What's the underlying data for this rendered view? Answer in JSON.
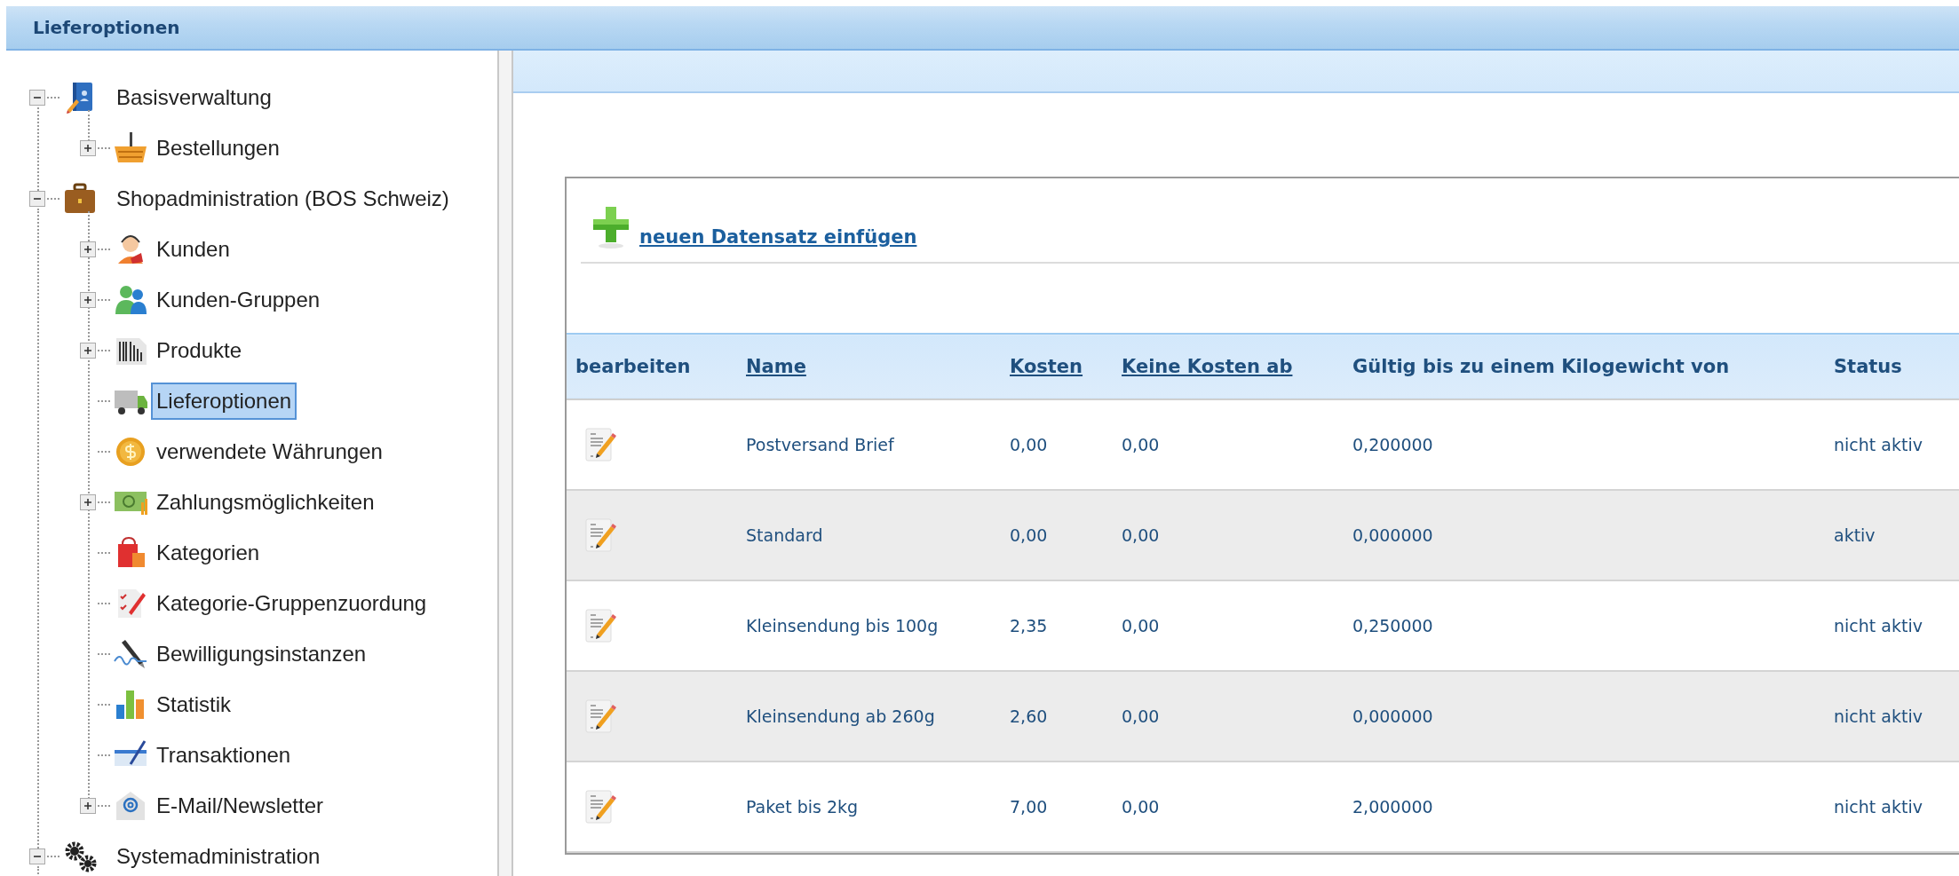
{
  "window": {
    "title": "Lieferoptionen"
  },
  "tree": [
    {
      "label": "Basisverwaltung",
      "kind": "folder",
      "expanded": true,
      "selected": false,
      "children": [
        {
          "label": "Bestellungen",
          "kind": "folder",
          "expanded": false,
          "selected": false
        }
      ]
    },
    {
      "label": "Shopadministration (BOS Schweiz)",
      "kind": "folder",
      "expanded": true,
      "selected": false,
      "children": [
        {
          "label": "Kunden",
          "kind": "folder",
          "expanded": false,
          "selected": false
        },
        {
          "label": "Kunden-Gruppen",
          "kind": "folder",
          "expanded": false,
          "selected": false
        },
        {
          "label": "Produkte",
          "kind": "folder",
          "expanded": false,
          "selected": false
        },
        {
          "label": "Lieferoptionen",
          "kind": "leaf",
          "selected": true
        },
        {
          "label": "verwendete Währungen",
          "kind": "leaf",
          "selected": false
        },
        {
          "label": "Zahlungsmöglichkeiten",
          "kind": "folder",
          "expanded": false,
          "selected": false
        },
        {
          "label": "Kategorien",
          "kind": "leaf",
          "selected": false
        },
        {
          "label": "Kategorie-Gruppenzuordung",
          "kind": "leaf",
          "selected": false
        },
        {
          "label": "Bewilligungsinstanzen",
          "kind": "leaf",
          "selected": false
        },
        {
          "label": "Statistik",
          "kind": "leaf",
          "selected": false
        },
        {
          "label": "Transaktionen",
          "kind": "leaf",
          "selected": false
        },
        {
          "label": "E-Mail/Newsletter",
          "kind": "folder",
          "expanded": false,
          "selected": false
        }
      ]
    },
    {
      "label": "Systemadministration",
      "kind": "folder",
      "expanded": true,
      "selected": false
    }
  ],
  "add_link": "neuen Datensatz einfügen",
  "table": {
    "columns": [
      {
        "label": "bearbeiten",
        "sortable": false
      },
      {
        "label": "Name",
        "sortable": true
      },
      {
        "label": "Kosten",
        "sortable": true
      },
      {
        "label": "Keine Kosten ab",
        "sortable": true
      },
      {
        "label": "Gültig bis zu einem Kilogewicht von",
        "sortable": false
      },
      {
        "label": "Status",
        "sortable": false
      }
    ],
    "rows": [
      {
        "name": "Postversand Brief",
        "kosten": "0,00",
        "keine_kosten_ab": "0,00",
        "gueltig_bis": "0,200000",
        "status": "nicht aktiv"
      },
      {
        "name": "Standard",
        "kosten": "0,00",
        "keine_kosten_ab": "0,00",
        "gueltig_bis": "0,000000",
        "status": "aktiv"
      },
      {
        "name": "Kleinsendung bis 100g",
        "kosten": "2,35",
        "keine_kosten_ab": "0,00",
        "gueltig_bis": "0,250000",
        "status": "nicht aktiv"
      },
      {
        "name": "Kleinsendung ab 260g",
        "kosten": "2,60",
        "keine_kosten_ab": "0,00",
        "gueltig_bis": "0,000000",
        "status": "nicht aktiv"
      },
      {
        "name": "Paket bis 2kg",
        "kosten": "7,00",
        "keine_kosten_ab": "0,00",
        "gueltig_bis": "2,000000",
        "status": "nicht aktiv"
      }
    ]
  }
}
